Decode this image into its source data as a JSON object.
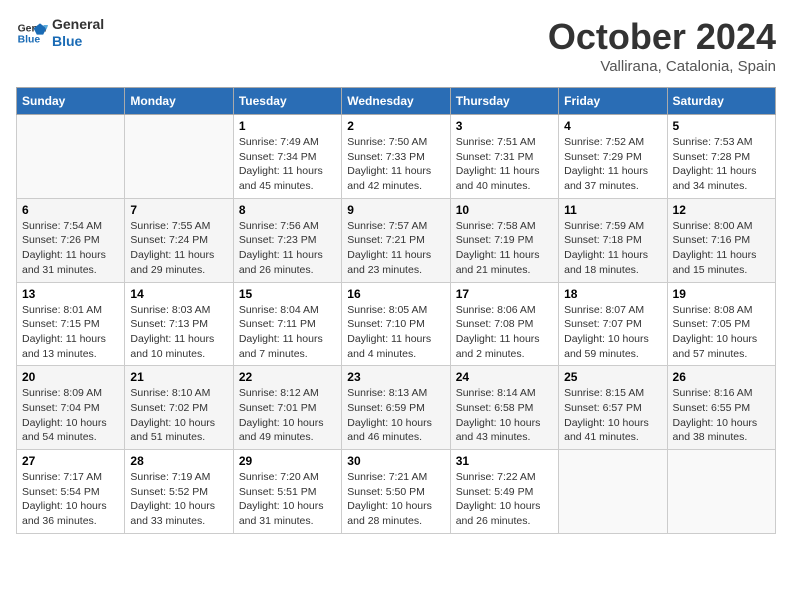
{
  "logo": {
    "line1": "General",
    "line2": "Blue"
  },
  "title": "October 2024",
  "subtitle": "Vallirana, Catalonia, Spain",
  "days_of_week": [
    "Sunday",
    "Monday",
    "Tuesday",
    "Wednesday",
    "Thursday",
    "Friday",
    "Saturday"
  ],
  "weeks": [
    [
      {
        "day": "",
        "info": ""
      },
      {
        "day": "",
        "info": ""
      },
      {
        "day": "1",
        "info": "Sunrise: 7:49 AM\nSunset: 7:34 PM\nDaylight: 11 hours and 45 minutes."
      },
      {
        "day": "2",
        "info": "Sunrise: 7:50 AM\nSunset: 7:33 PM\nDaylight: 11 hours and 42 minutes."
      },
      {
        "day": "3",
        "info": "Sunrise: 7:51 AM\nSunset: 7:31 PM\nDaylight: 11 hours and 40 minutes."
      },
      {
        "day": "4",
        "info": "Sunrise: 7:52 AM\nSunset: 7:29 PM\nDaylight: 11 hours and 37 minutes."
      },
      {
        "day": "5",
        "info": "Sunrise: 7:53 AM\nSunset: 7:28 PM\nDaylight: 11 hours and 34 minutes."
      }
    ],
    [
      {
        "day": "6",
        "info": "Sunrise: 7:54 AM\nSunset: 7:26 PM\nDaylight: 11 hours and 31 minutes."
      },
      {
        "day": "7",
        "info": "Sunrise: 7:55 AM\nSunset: 7:24 PM\nDaylight: 11 hours and 29 minutes."
      },
      {
        "day": "8",
        "info": "Sunrise: 7:56 AM\nSunset: 7:23 PM\nDaylight: 11 hours and 26 minutes."
      },
      {
        "day": "9",
        "info": "Sunrise: 7:57 AM\nSunset: 7:21 PM\nDaylight: 11 hours and 23 minutes."
      },
      {
        "day": "10",
        "info": "Sunrise: 7:58 AM\nSunset: 7:19 PM\nDaylight: 11 hours and 21 minutes."
      },
      {
        "day": "11",
        "info": "Sunrise: 7:59 AM\nSunset: 7:18 PM\nDaylight: 11 hours and 18 minutes."
      },
      {
        "day": "12",
        "info": "Sunrise: 8:00 AM\nSunset: 7:16 PM\nDaylight: 11 hours and 15 minutes."
      }
    ],
    [
      {
        "day": "13",
        "info": "Sunrise: 8:01 AM\nSunset: 7:15 PM\nDaylight: 11 hours and 13 minutes."
      },
      {
        "day": "14",
        "info": "Sunrise: 8:03 AM\nSunset: 7:13 PM\nDaylight: 11 hours and 10 minutes."
      },
      {
        "day": "15",
        "info": "Sunrise: 8:04 AM\nSunset: 7:11 PM\nDaylight: 11 hours and 7 minutes."
      },
      {
        "day": "16",
        "info": "Sunrise: 8:05 AM\nSunset: 7:10 PM\nDaylight: 11 hours and 4 minutes."
      },
      {
        "day": "17",
        "info": "Sunrise: 8:06 AM\nSunset: 7:08 PM\nDaylight: 11 hours and 2 minutes."
      },
      {
        "day": "18",
        "info": "Sunrise: 8:07 AM\nSunset: 7:07 PM\nDaylight: 10 hours and 59 minutes."
      },
      {
        "day": "19",
        "info": "Sunrise: 8:08 AM\nSunset: 7:05 PM\nDaylight: 10 hours and 57 minutes."
      }
    ],
    [
      {
        "day": "20",
        "info": "Sunrise: 8:09 AM\nSunset: 7:04 PM\nDaylight: 10 hours and 54 minutes."
      },
      {
        "day": "21",
        "info": "Sunrise: 8:10 AM\nSunset: 7:02 PM\nDaylight: 10 hours and 51 minutes."
      },
      {
        "day": "22",
        "info": "Sunrise: 8:12 AM\nSunset: 7:01 PM\nDaylight: 10 hours and 49 minutes."
      },
      {
        "day": "23",
        "info": "Sunrise: 8:13 AM\nSunset: 6:59 PM\nDaylight: 10 hours and 46 minutes."
      },
      {
        "day": "24",
        "info": "Sunrise: 8:14 AM\nSunset: 6:58 PM\nDaylight: 10 hours and 43 minutes."
      },
      {
        "day": "25",
        "info": "Sunrise: 8:15 AM\nSunset: 6:57 PM\nDaylight: 10 hours and 41 minutes."
      },
      {
        "day": "26",
        "info": "Sunrise: 8:16 AM\nSunset: 6:55 PM\nDaylight: 10 hours and 38 minutes."
      }
    ],
    [
      {
        "day": "27",
        "info": "Sunrise: 7:17 AM\nSunset: 5:54 PM\nDaylight: 10 hours and 36 minutes."
      },
      {
        "day": "28",
        "info": "Sunrise: 7:19 AM\nSunset: 5:52 PM\nDaylight: 10 hours and 33 minutes."
      },
      {
        "day": "29",
        "info": "Sunrise: 7:20 AM\nSunset: 5:51 PM\nDaylight: 10 hours and 31 minutes."
      },
      {
        "day": "30",
        "info": "Sunrise: 7:21 AM\nSunset: 5:50 PM\nDaylight: 10 hours and 28 minutes."
      },
      {
        "day": "31",
        "info": "Sunrise: 7:22 AM\nSunset: 5:49 PM\nDaylight: 10 hours and 26 minutes."
      },
      {
        "day": "",
        "info": ""
      },
      {
        "day": "",
        "info": ""
      }
    ]
  ]
}
